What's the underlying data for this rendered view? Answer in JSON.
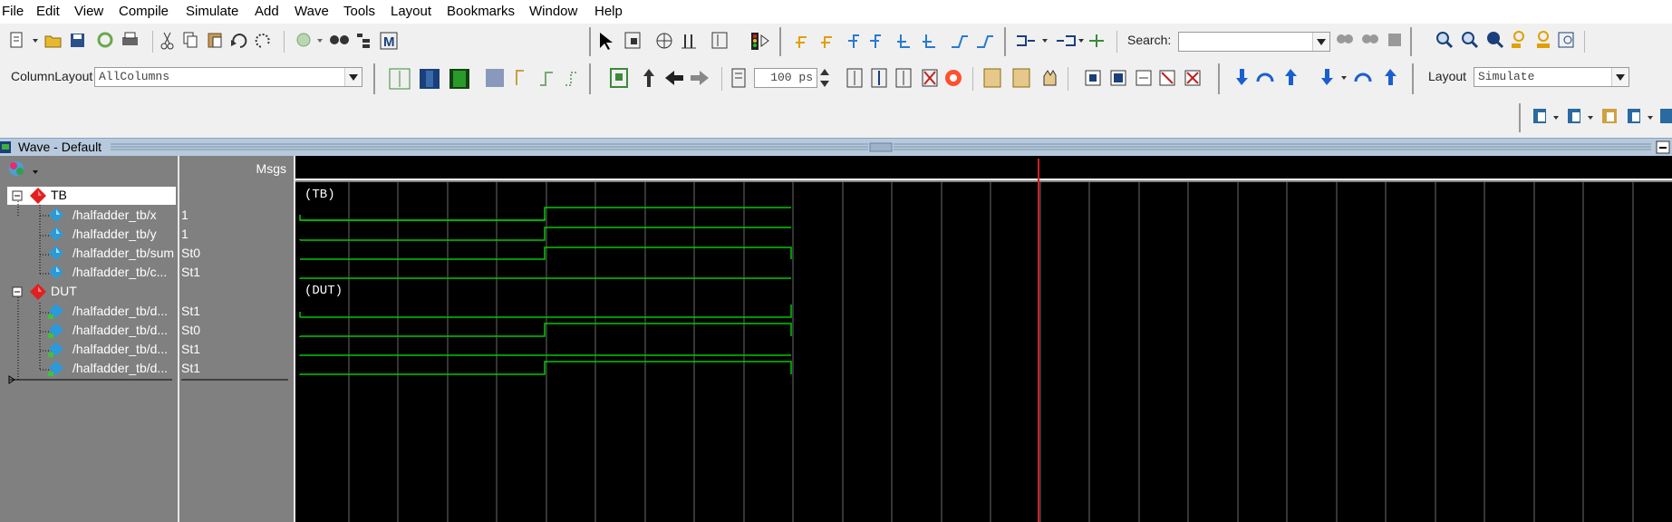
{
  "menu": [
    "File",
    "Edit",
    "View",
    "Compile",
    "Simulate",
    "Add",
    "Wave",
    "Tools",
    "Layout",
    "Bookmarks",
    "Window",
    "Help"
  ],
  "toolbar": {
    "search_label": "Search:",
    "column_layout_label": "ColumnLayout",
    "column_layout_value": "AllColumns",
    "run_length_value": "100 ps",
    "layout_label": "Layout",
    "layout_value": "Simulate"
  },
  "panel": {
    "title": "Wave - Default",
    "msgs_header": "Msgs"
  },
  "groups": [
    {
      "name": "TB",
      "wave_label": "(TB)"
    },
    {
      "name": "DUT",
      "wave_label": "(DUT)"
    }
  ],
  "signals": [
    {
      "name": "/halfadder_tb/x",
      "value": "1"
    },
    {
      "name": "/halfadder_tb/y",
      "value": "1"
    },
    {
      "name": "/halfadder_tb/sum",
      "value": "St0"
    },
    {
      "name": "/halfadder_tb/c...",
      "value": "St1"
    },
    {
      "name": "/halfadder_tb/d...",
      "value": "St1"
    },
    {
      "name": "/halfadder_tb/d...",
      "value": "St0"
    },
    {
      "name": "/halfadder_tb/d...",
      "value": "St1"
    },
    {
      "name": "/halfadder_tb/d...",
      "value": "St1"
    }
  ],
  "colors": {
    "wave": "#00c800",
    "cursor": "#d02020",
    "grid": "#6a6a6a",
    "canvas_bg": "#000000",
    "panel_title_bg": "#b7c9dc",
    "tree_bg": "#808080"
  },
  "icons": [
    "new-file-icon",
    "open-icon",
    "save-icon",
    "reload-icon",
    "print-icon",
    "cut-icon",
    "copy-icon",
    "paste-icon",
    "undo-icon",
    "redo-icon",
    "compile-icon",
    "find-icon",
    "zoom-in-icon",
    "zoom-out-icon",
    "zoom-full-icon",
    "run-icon",
    "stop-icon",
    "step-icon",
    "add-wave-icon"
  ]
}
